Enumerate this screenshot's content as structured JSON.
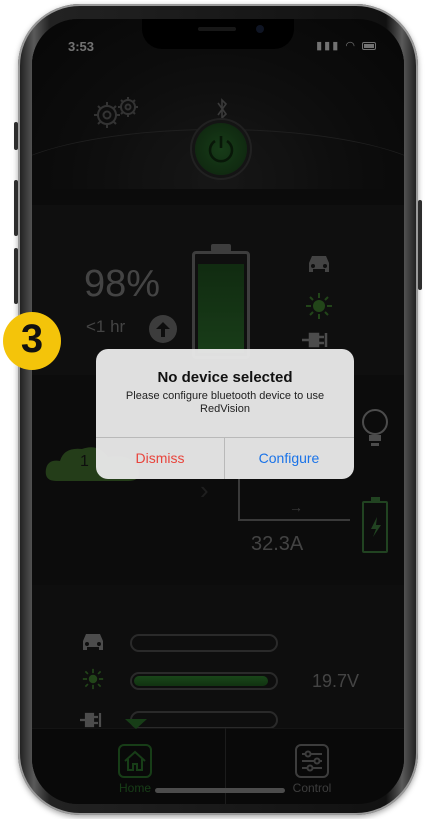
{
  "step_badge": "3",
  "status_bar": {
    "time": "3:53",
    "signal": "•ıl"
  },
  "battery": {
    "percent": "98%",
    "time_left": "<1 hr",
    "charge_level": 0.98
  },
  "flow": {
    "cloud_value": "1",
    "current": "32.3A"
  },
  "sources": {
    "rows": [
      {
        "name": "car",
        "level": 0,
        "value": ""
      },
      {
        "name": "solar",
        "level": 0.96,
        "value": "19.7V"
      },
      {
        "name": "shore",
        "level": 0,
        "value": ""
      }
    ]
  },
  "tabs": [
    {
      "label": "Home",
      "active": true
    },
    {
      "label": "Control",
      "active": false
    }
  ],
  "alert": {
    "title": "No device selected",
    "message": "Please configure bluetooth device to use RedVision",
    "dismiss_label": "Dismiss",
    "configure_label": "Configure"
  },
  "colors": {
    "accent_green": "#2a6f2a",
    "dismiss_red": "#e8443c",
    "configure_blue": "#1a73e8",
    "badge_yellow": "#f4c40a"
  }
}
